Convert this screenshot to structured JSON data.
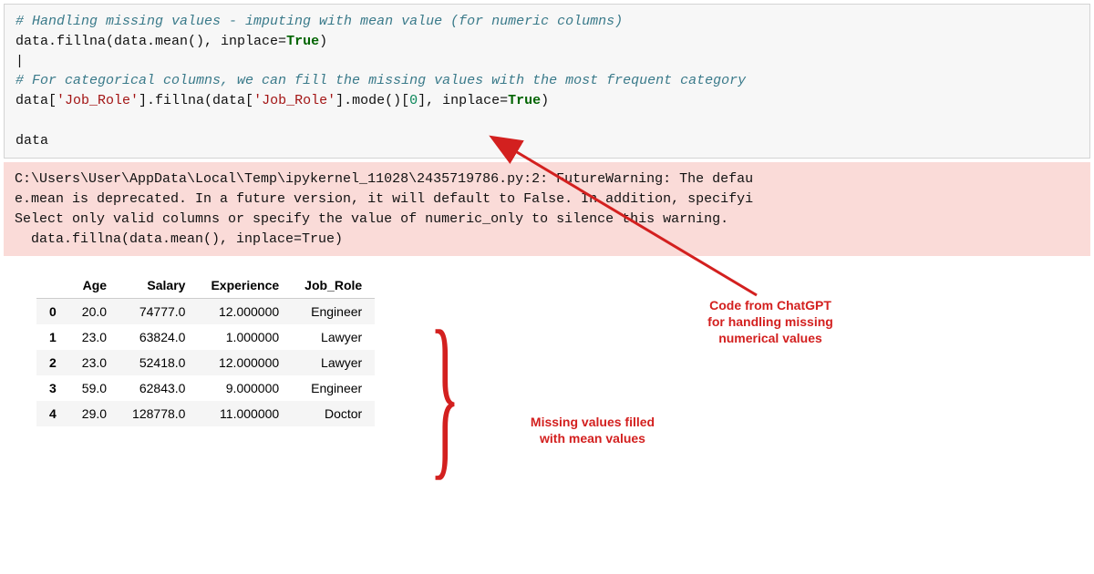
{
  "code": {
    "line1_comment": "# Handling missing values - imputing with mean value (for numeric columns)",
    "line2_a": "data.fillna(data.mean(), inplace=",
    "line2_true": "True",
    "line2_b": ")",
    "cursor_line": "|",
    "line4_comment": "# For categorical columns, we can fill the missing values with the most frequent category",
    "line5_a": "data[",
    "line5_s1": "'Job_Role'",
    "line5_b": "].fillna(data[",
    "line5_s2": "'Job_Role'",
    "line5_c": "].mode()[",
    "line5_zero": "0",
    "line5_d": "], inplace=",
    "line5_true": "True",
    "line5_e": ")",
    "line7": "data"
  },
  "warning": {
    "l1": "C:\\Users\\User\\AppData\\Local\\Temp\\ipykernel_11028\\2435719786.py:2: FutureWarning: The defau",
    "l2": "e.mean is deprecated. In a future version, it will default to False. In addition, specifyi",
    "l3": "Select only valid columns or specify the value of numeric_only to silence this warning.",
    "l4": "  data.fillna(data.mean(), inplace=True)"
  },
  "table": {
    "headers": [
      "",
      "Age",
      "Salary",
      "Experience",
      "Job_Role"
    ],
    "rows": [
      {
        "idx": "0",
        "Age": "20.0",
        "Salary": "74777.0",
        "Experience": "12.000000",
        "Job_Role": "Engineer"
      },
      {
        "idx": "1",
        "Age": "23.0",
        "Salary": "63824.0",
        "Experience": "1.000000",
        "Job_Role": "Lawyer"
      },
      {
        "idx": "2",
        "Age": "23.0",
        "Salary": "52418.0",
        "Experience": "12.000000",
        "Job_Role": "Lawyer"
      },
      {
        "idx": "3",
        "Age": "59.0",
        "Salary": "62843.0",
        "Experience": "9.000000",
        "Job_Role": "Engineer"
      },
      {
        "idx": "4",
        "Age": "29.0",
        "Salary": "128778.0",
        "Experience": "11.000000",
        "Job_Role": "Doctor"
      }
    ]
  },
  "annotations": {
    "top": "Code from ChatGPT\nfor handling missing\nnumerical values",
    "mid": "Missing values filled\nwith mean values"
  },
  "colors": {
    "annotation_red": "#d3201f",
    "warning_bg": "#fadbd8",
    "code_bg": "#f7f7f7"
  }
}
